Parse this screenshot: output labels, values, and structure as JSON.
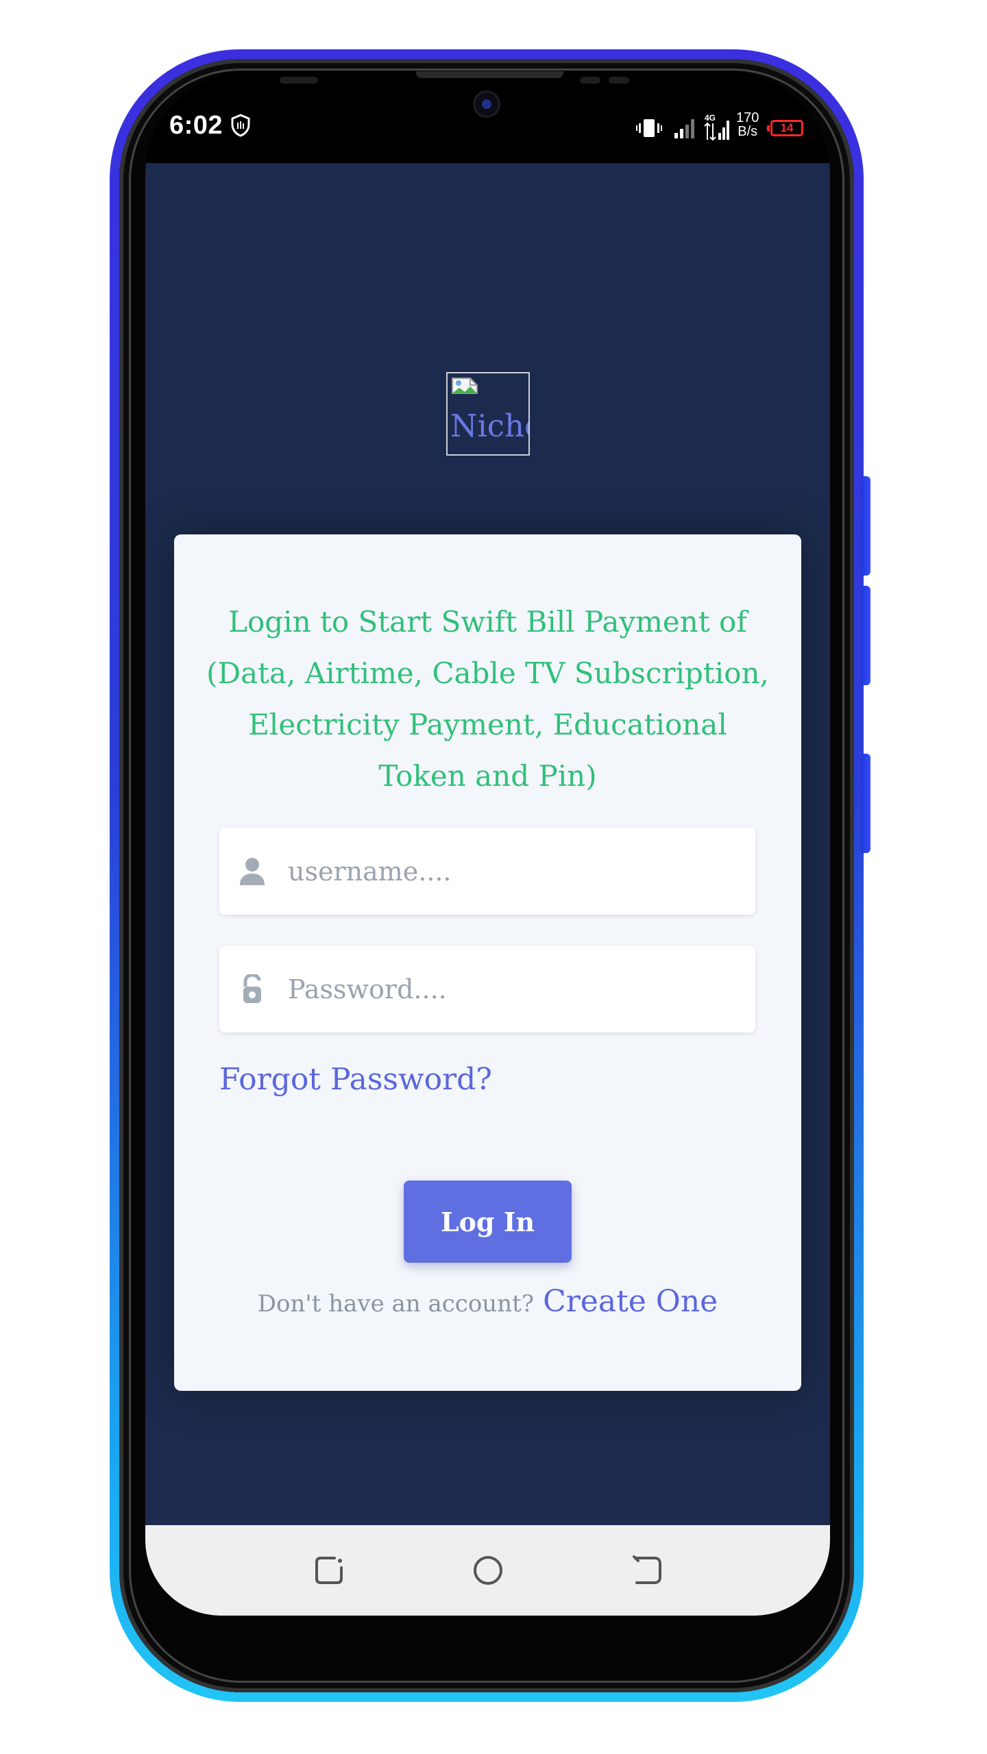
{
  "status_bar": {
    "time": "6:02",
    "network_type": "4G",
    "speed_value": "170",
    "speed_unit": "B/s",
    "battery_level": "14"
  },
  "logo": {
    "alt_text": "Nicho"
  },
  "login_card": {
    "heading": "Login to Start Swift Bill Payment of (Data, Airtime, Cable TV Subscription, Electricity Payment, Educational Token and Pin)",
    "username_placeholder": "username....",
    "password_placeholder": "Password....",
    "forgot_password": "Forgot Password?",
    "login_button": "Log In",
    "no_account_text": "Don't have an account?",
    "create_account": "Create One"
  },
  "colors": {
    "background": "#1c2b4d",
    "heading": "#30c07a",
    "accent": "#5f6fe1",
    "link": "#5b66dc",
    "card": "#f3f6fa",
    "battery_low": "#ff2a2a"
  },
  "icons": {
    "status": [
      "shield-icon",
      "vibrate-icon",
      "signal-icon",
      "battery-icon"
    ],
    "inputs": [
      "user-icon",
      "lock-open-icon"
    ],
    "nav": [
      "recent-apps-icon",
      "home-icon",
      "back-icon"
    ]
  }
}
